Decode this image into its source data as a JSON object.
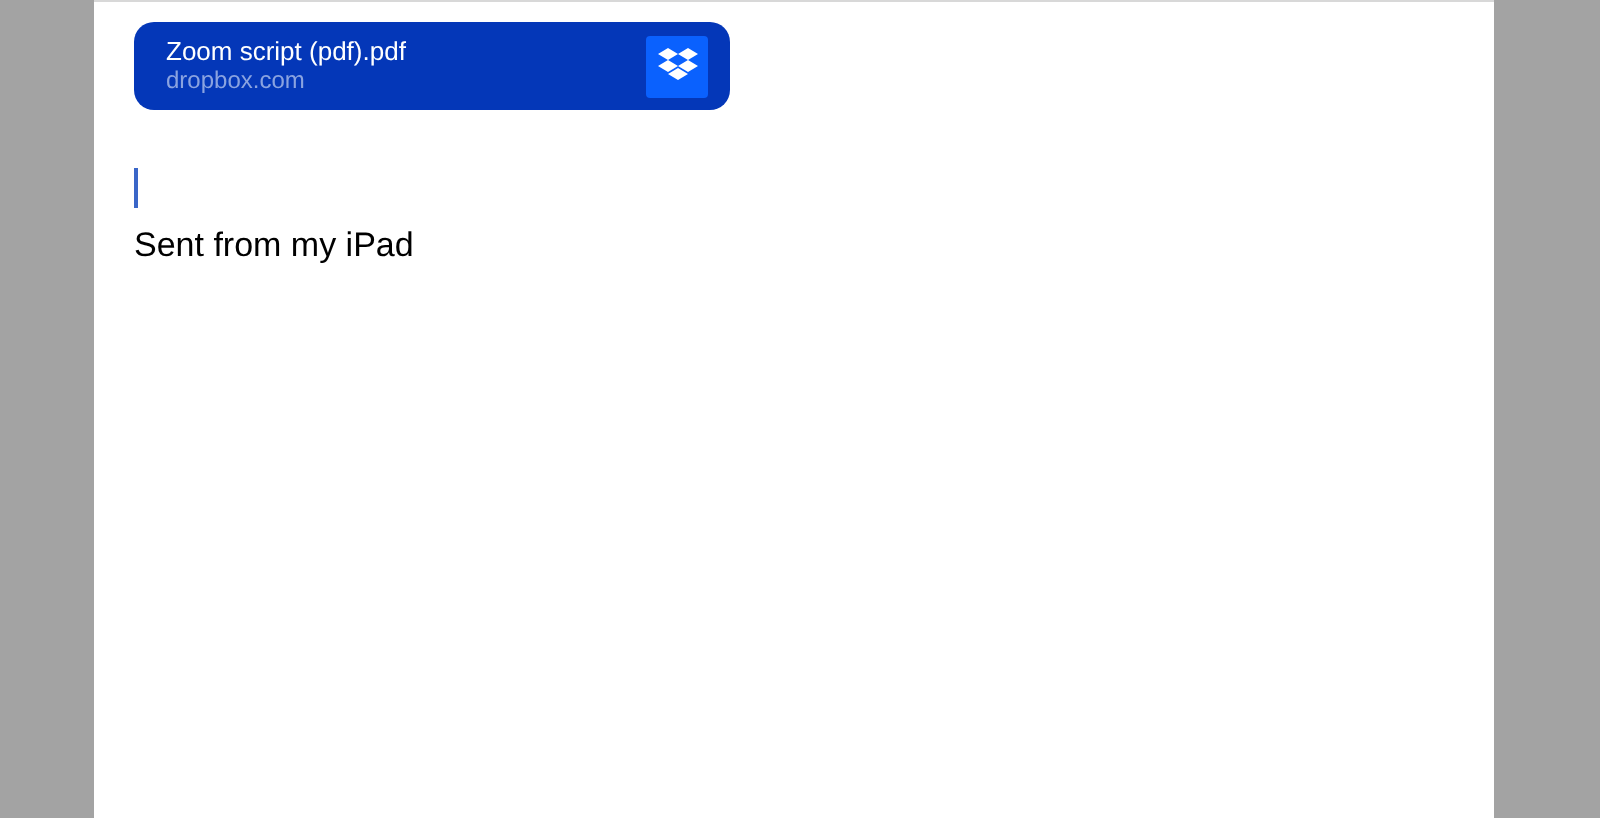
{
  "attachment": {
    "title": "Zoom script (pdf).pdf",
    "source": "dropbox.com"
  },
  "signature": "Sent from my iPad"
}
